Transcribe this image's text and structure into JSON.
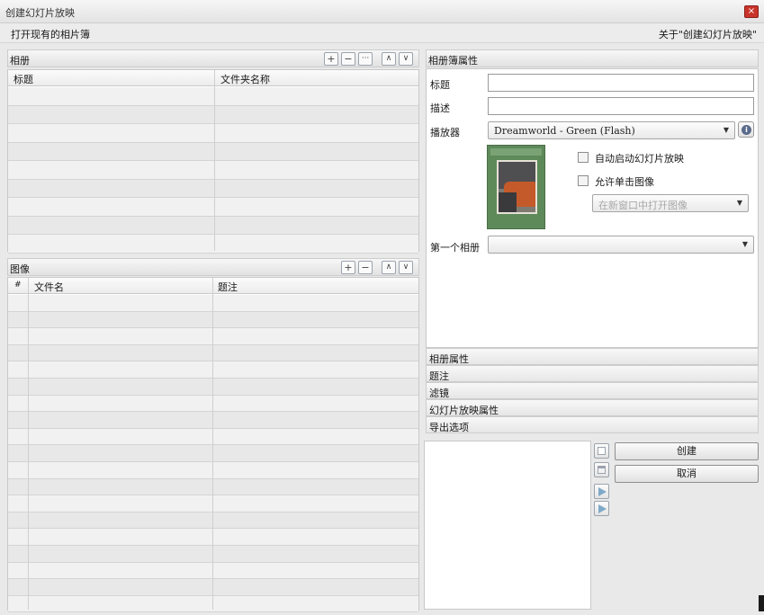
{
  "window": {
    "title": "创建幻灯片放映",
    "close": "×"
  },
  "menu": {
    "open_album": "打开现有的相片簿",
    "about": "关于\"创建幻灯片放映\""
  },
  "albums": {
    "header": "相册",
    "columns": [
      "标题",
      "文件夹名称"
    ],
    "tools": {
      "add": "+",
      "remove": "−",
      "more": "···",
      "up": "∧",
      "down": "∨"
    }
  },
  "images": {
    "header": "图像",
    "columns": [
      "#",
      "文件名",
      "题注"
    ],
    "tools": {
      "add": "+",
      "remove": "−",
      "up": "∧",
      "down": "∨"
    }
  },
  "album_props": {
    "header": "相册簿属性",
    "title_label": "标题",
    "title_value": "",
    "desc_label": "描述",
    "desc_value": "",
    "player_label": "播放器",
    "player_value": "Dreamworld - Green (Flash)",
    "autostart_label": "自动启动幻灯片放映",
    "allow_click_label": "允许单击图像",
    "open_mode_value": "在新窗口中打开图像",
    "first_album_label": "第一个相册",
    "first_album_value": ""
  },
  "sections": [
    "相册属性",
    "题注",
    "滤镜",
    "幻灯片放映属性",
    "导出选项"
  ],
  "actions": {
    "create": "创建",
    "cancel": "取消"
  }
}
